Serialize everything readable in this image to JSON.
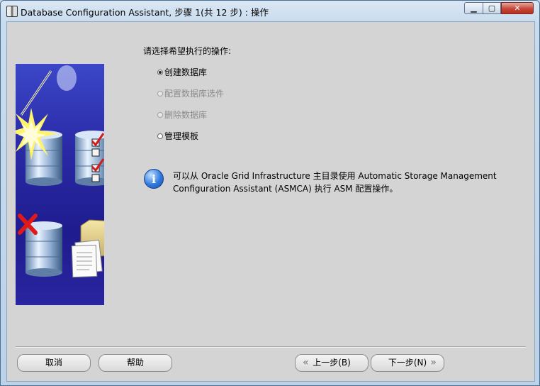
{
  "window": {
    "title": "Database Configuration Assistant, 步骤 1(共 12 步) : 操作",
    "minimize_glyph": "▁",
    "maximize_glyph": "▢",
    "close_glyph": "✕"
  },
  "main": {
    "prompt": "请选择希望执行的操作:",
    "options": [
      {
        "label": "创建数据库",
        "selected": true,
        "enabled": true
      },
      {
        "label": "配置数据库选件",
        "selected": false,
        "enabled": false
      },
      {
        "label": "删除数据库",
        "selected": false,
        "enabled": false
      },
      {
        "label": "管理模板",
        "selected": false,
        "enabled": true
      }
    ],
    "info_icon_glyph": "i",
    "info_text": "可以从 Oracle Grid Infrastructure 主目录使用 Automatic Storage Management Configuration Assistant (ASMCA) 执行 ASM 配置操作。"
  },
  "buttons": {
    "cancel": "取消",
    "help": "帮助",
    "back": "上一步(B)",
    "next": "下一步(N)",
    "back_chevron": "«",
    "next_chevron": "»"
  },
  "colors": {
    "image_background": "#2a2aa6",
    "client_background": "#d4d4d4",
    "disabled_text": "#8c8c8c"
  }
}
